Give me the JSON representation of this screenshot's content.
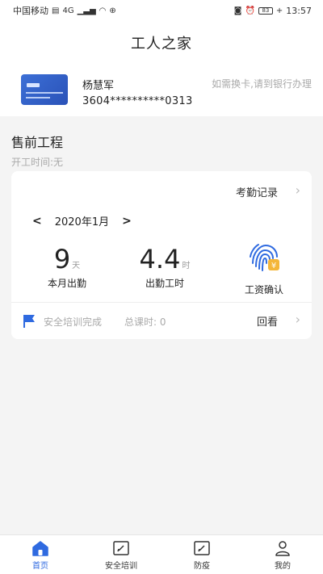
{
  "status_bar": {
    "carrier": "中国移动",
    "network": "4G",
    "battery": "83",
    "time": "13:57"
  },
  "header": {
    "title": "工人之家"
  },
  "bank_card": {
    "holder_name": "杨慧军",
    "hint": "如需换卡,请到银行办理",
    "number": "3604**********0313"
  },
  "project": {
    "title": "售前工程",
    "start_time": "开工时间:无"
  },
  "attendance": {
    "records_link": "考勤记录",
    "prev_arrow": "<",
    "month": "2020年1月",
    "next_arrow": ">",
    "days_value": "9",
    "days_unit": "天",
    "days_label": "本月出勤",
    "hours_value": "4.4",
    "hours_unit": "时",
    "hours_label": "出勤工时",
    "salary_label": "工资确认"
  },
  "training": {
    "status": "安全培训完成",
    "hours": "总课时: 0",
    "replay": "回看"
  },
  "tabs": [
    {
      "label": "首页"
    },
    {
      "label": "安全培训"
    },
    {
      "label": "防疫"
    },
    {
      "label": "我的"
    }
  ],
  "colors": {
    "accent": "#2f6ae0",
    "card_blue": "#2a52b8",
    "background": "#f4f4f4"
  }
}
